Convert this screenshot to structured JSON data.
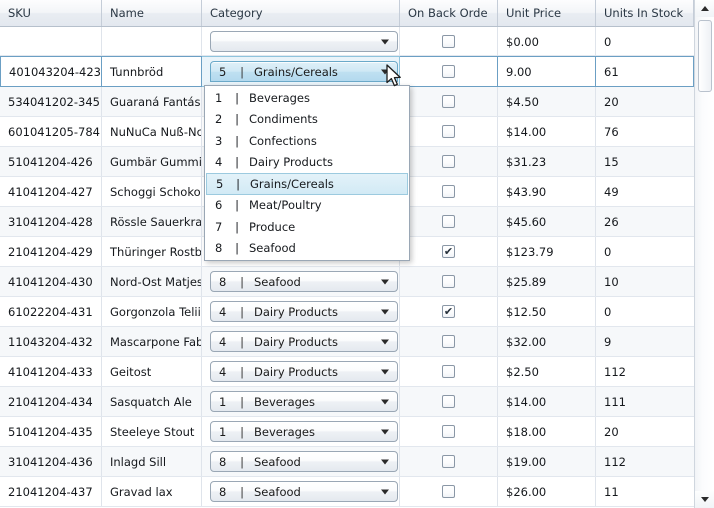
{
  "grid": {
    "columns": [
      {
        "key": "sku",
        "label": "SKU"
      },
      {
        "key": "name",
        "label": "Name"
      },
      {
        "key": "cat",
        "label": "Category"
      },
      {
        "key": "back",
        "label": "On Back Orde"
      },
      {
        "key": "price",
        "label": "Unit Price"
      },
      {
        "key": "stock",
        "label": "Units In Stock"
      }
    ],
    "new_row": {
      "sku": "",
      "name": "",
      "category_placeholder": "",
      "on_back_order": false,
      "unit_price": "$0.00",
      "units_in_stock": "0"
    },
    "rows": [
      {
        "sku": "401043204-423",
        "name": "Tunnbröd",
        "category_index": "5",
        "category_label": "Grains/Cereals",
        "on_back_order": false,
        "unit_price": "9.00",
        "units_in_stock": "61",
        "selected": true,
        "editing": true
      },
      {
        "sku": "534041202-345",
        "name": "Guaraná Fantás",
        "category_index": "",
        "category_label": "",
        "on_back_order": false,
        "unit_price": "$4.50",
        "units_in_stock": "20",
        "selected": false,
        "editing": false
      },
      {
        "sku": "601041205-784",
        "name": "NuNuCa Nuß-Nc",
        "category_index": "",
        "category_label": "",
        "on_back_order": false,
        "unit_price": "$14.00",
        "units_in_stock": "76",
        "selected": false,
        "editing": false
      },
      {
        "sku": "51041204-426",
        "name": "Gumbär Gummi",
        "category_index": "",
        "category_label": "",
        "on_back_order": false,
        "unit_price": "$31.23",
        "units_in_stock": "15",
        "selected": false,
        "editing": false
      },
      {
        "sku": "41041204-427",
        "name": "Schoggi Schoko",
        "category_index": "",
        "category_label": "",
        "on_back_order": false,
        "unit_price": "$43.90",
        "units_in_stock": "49",
        "selected": false,
        "editing": false
      },
      {
        "sku": "31041204-428",
        "name": "Rössle Sauerkra",
        "category_index": "",
        "category_label": "",
        "on_back_order": false,
        "unit_price": "$45.60",
        "units_in_stock": "26",
        "selected": false,
        "editing": false
      },
      {
        "sku": "21041204-429",
        "name": "Thüringer Rostb",
        "category_index": "",
        "category_label": "",
        "on_back_order": true,
        "unit_price": "$123.79",
        "units_in_stock": "0",
        "selected": false,
        "editing": false
      },
      {
        "sku": "41041204-430",
        "name": "Nord-Ost Matjes",
        "category_index": "8",
        "category_label": "Seafood",
        "on_back_order": false,
        "unit_price": "$25.89",
        "units_in_stock": "10",
        "selected": false,
        "editing": false
      },
      {
        "sku": "61022204-431",
        "name": "Gorgonzola Telii",
        "category_index": "4",
        "category_label": "Dairy Products",
        "on_back_order": true,
        "unit_price": "$12.50",
        "units_in_stock": "0",
        "selected": false,
        "editing": false
      },
      {
        "sku": "11043204-432",
        "name": "Mascarpone Fab",
        "category_index": "4",
        "category_label": "Dairy Products",
        "on_back_order": false,
        "unit_price": "$32.00",
        "units_in_stock": "9",
        "selected": false,
        "editing": false
      },
      {
        "sku": "41041204-433",
        "name": "Geitost",
        "category_index": "4",
        "category_label": "Dairy Products",
        "on_back_order": false,
        "unit_price": "$2.50",
        "units_in_stock": "112",
        "selected": false,
        "editing": false
      },
      {
        "sku": "21041204-434",
        "name": "Sasquatch Ale",
        "category_index": "1",
        "category_label": "Beverages",
        "on_back_order": false,
        "unit_price": "$14.00",
        "units_in_stock": "111",
        "selected": false,
        "editing": false
      },
      {
        "sku": "51041204-435",
        "name": "Steeleye Stout",
        "category_index": "1",
        "category_label": "Beverages",
        "on_back_order": false,
        "unit_price": "$18.00",
        "units_in_stock": "20",
        "selected": false,
        "editing": false
      },
      {
        "sku": "31041204-436",
        "name": "Inlagd Sill",
        "category_index": "8",
        "category_label": "Seafood",
        "on_back_order": false,
        "unit_price": "$19.00",
        "units_in_stock": "112",
        "selected": false,
        "editing": false
      },
      {
        "sku": "21041204-437",
        "name": "Gravad lax",
        "category_index": "8",
        "category_label": "Seafood",
        "on_back_order": false,
        "unit_price": "$26.00",
        "units_in_stock": "11",
        "selected": false,
        "editing": false
      }
    ]
  },
  "dropdown": {
    "open": true,
    "selected_index": "5",
    "separator": "|",
    "options": [
      {
        "index": "1",
        "label": "Beverages"
      },
      {
        "index": "2",
        "label": "Condiments"
      },
      {
        "index": "3",
        "label": "Confections"
      },
      {
        "index": "4",
        "label": "Dairy Products"
      },
      {
        "index": "5",
        "label": "Grains/Cereals"
      },
      {
        "index": "6",
        "label": "Meat/Poultry"
      },
      {
        "index": "7",
        "label": "Produce"
      },
      {
        "index": "8",
        "label": "Seafood"
      }
    ]
  },
  "scrollbar": {
    "up_arrow": "scroll-up",
    "down_arrow": "scroll-down",
    "thumb": "scroll-thumb"
  },
  "icons": {
    "checkbox_tick": "✔",
    "combo_arrow": "chevron-down-icon",
    "cursor": "mouse-pointer"
  },
  "colors": {
    "selected_row_border": "#6b9fc4",
    "dropdown_highlight": "#d2eaf5",
    "header_bg": "#e9edf2",
    "alt_row_bg": "#f6f8fa"
  }
}
